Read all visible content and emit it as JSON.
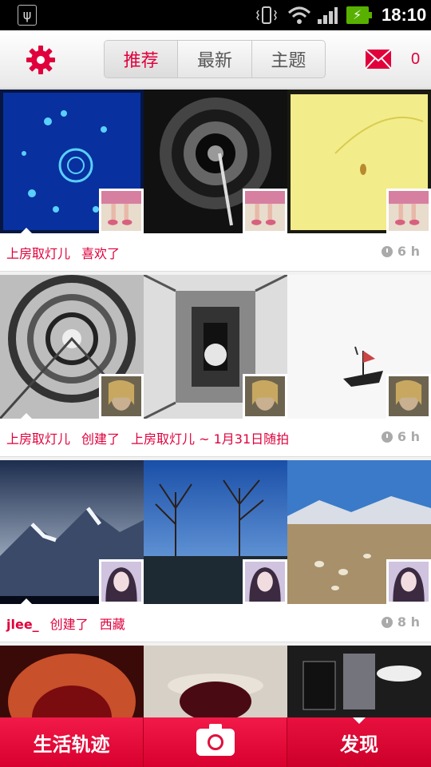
{
  "status_bar": {
    "time": "18:10"
  },
  "header": {
    "tabs": [
      {
        "label": "推荐",
        "active": true
      },
      {
        "label": "最新",
        "active": false
      },
      {
        "label": "主题",
        "active": false
      }
    ],
    "message_count": "0",
    "accent_color": "#e0003c"
  },
  "feed": [
    {
      "user": "上房取灯儿",
      "action": "喜欢了",
      "subject": "",
      "time": "6 h"
    },
    {
      "user": "上房取灯儿",
      "action": "创建了",
      "subject": "上房取灯儿 ~ 1月31日随拍",
      "time": "6 h"
    },
    {
      "user": "jlee_",
      "action": "创建了",
      "subject": "西藏",
      "time": "8 h"
    }
  ],
  "bottom_nav": {
    "left_label": "生活轨迹",
    "camera_icon": "camera-icon",
    "right_label": "发现"
  }
}
